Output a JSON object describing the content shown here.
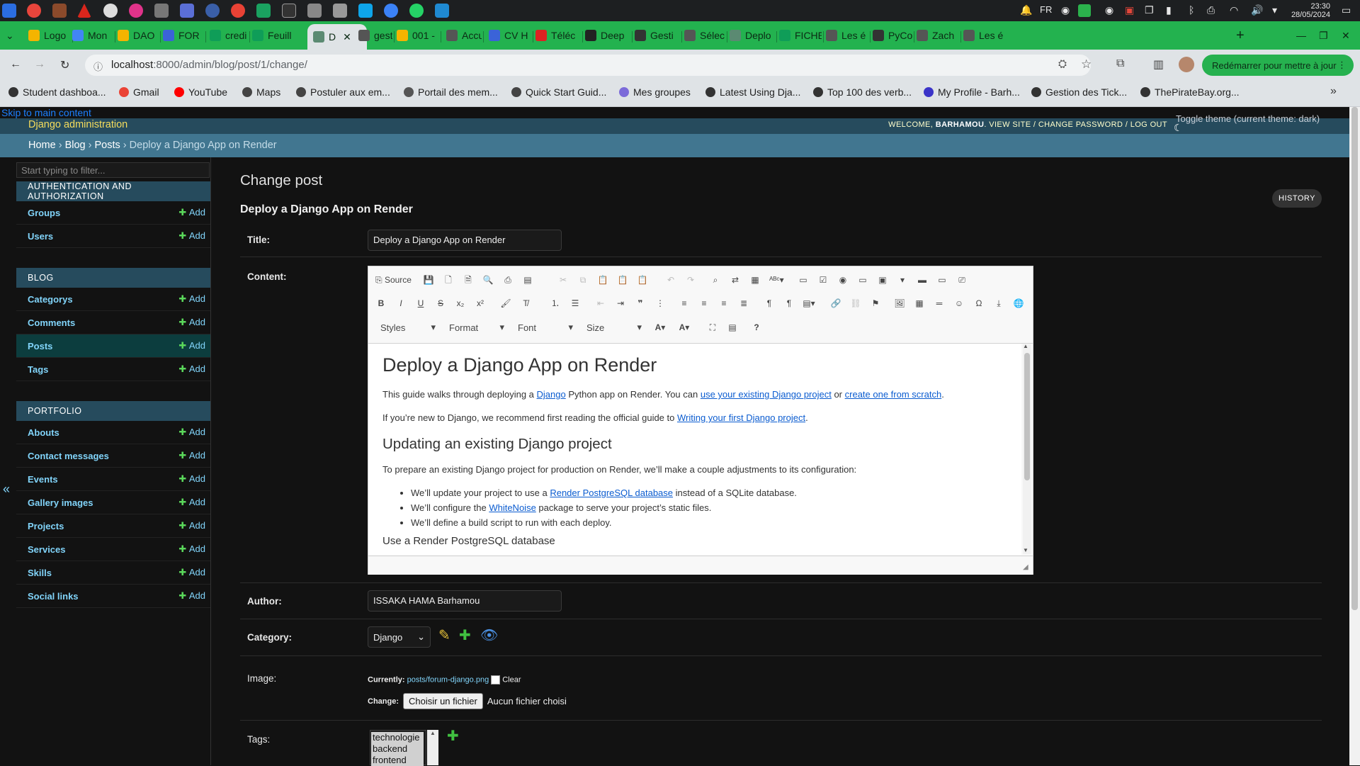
{
  "os": {
    "tray_lang": "FR",
    "clock_time": "23:30",
    "clock_date": "28/05/2024"
  },
  "browser": {
    "tabs": [
      {
        "label": "Logo",
        "color": "#f4b400"
      },
      {
        "label": "Mon",
        "color": "#4285f4"
      },
      {
        "label": "DAO",
        "color": "#f4b400"
      },
      {
        "label": "FOR",
        "color": "#3b63d8"
      },
      {
        "label": "credi",
        "color": "#0f9d58"
      },
      {
        "label": "Feuill",
        "color": "#0f9d58"
      },
      {
        "label": "D",
        "color": "#5b8a72"
      },
      {
        "label": "gestio",
        "color": "#555555"
      },
      {
        "label": "001 -",
        "color": "#f4b400"
      },
      {
        "label": "Accu",
        "color": "#555555"
      },
      {
        "label": "CV H",
        "color": "#3b63d8"
      },
      {
        "label": "Téléc",
        "color": "#d22"
      },
      {
        "label": "Deep",
        "color": "#222"
      },
      {
        "label": "Gesti",
        "color": "#333"
      },
      {
        "label": "Sélec",
        "color": "#555555"
      },
      {
        "label": "Deplo",
        "color": "#5b8a72"
      },
      {
        "label": "FICHE",
        "color": "#0f9d58"
      },
      {
        "label": "Les é",
        "color": "#555555"
      },
      {
        "label": "PyCo",
        "color": "#333"
      },
      {
        "label": "Zach",
        "color": "#555555"
      },
      {
        "label": "Les é",
        "color": "#555555"
      }
    ],
    "url_host": "localhost",
    "url_path": ":8000/admin/blog/post/1/change/",
    "restart_label": "Redémarrer pour mettre à jour",
    "bookmarks": [
      "Student dashboa...",
      "Gmail",
      "YouTube",
      "Maps",
      "Postuler aux em...",
      "Portail des mem...",
      "Quick Start Guid...",
      "Mes groupes",
      "Latest Using Dja...",
      "Top 100 des verb...",
      "My Profile - Barh...",
      "Gestion des Tick...",
      "ThePirateBay.org..."
    ]
  },
  "admin": {
    "skip_link": "Skip to main content",
    "brand": "Django administration",
    "welcome": "Welcome,",
    "username": "BARHAMOU",
    "user_links": [
      "View site",
      "Change password",
      "Log out"
    ],
    "toggle_theme": "Toggle theme (current theme: dark)",
    "breadcrumbs": [
      "Home",
      "Blog",
      "Posts",
      "Deploy a Django App on Render"
    ],
    "filter_placeholder": "Start typing to filter...",
    "add_label": "Add",
    "modules": [
      {
        "caption": "Authentication and Authorization",
        "models": [
          "Groups",
          "Users"
        ]
      },
      {
        "caption": "Blog",
        "models": [
          "Categorys",
          "Comments",
          "Posts",
          "Tags"
        ]
      },
      {
        "caption": "Portfolio",
        "models": [
          "Abouts",
          "Contact messages",
          "Events",
          "Gallery images",
          "Projects",
          "Services",
          "Skills",
          "Social links"
        ]
      }
    ],
    "selected_model": "Posts"
  },
  "form": {
    "page_title": "Change post",
    "object_title": "Deploy a Django App on Render",
    "history_label": "HISTORY",
    "title_label": "Title:",
    "title_value": "Deploy a Django App on Render",
    "content_label": "Content:",
    "author_label": "Author:",
    "author_value": "ISSAKA HAMA Barhamou",
    "category_label": "Category:",
    "category_value": "Django",
    "image_label": "Image:",
    "currently_label": "Currently:",
    "current_file": "posts/forum-django.png",
    "clear_label": "Clear",
    "change_label": "Change:",
    "file_button": "Choisir un fichier",
    "no_file": "Aucun fichier choisi",
    "tags_label": "Tags:",
    "tags_options": [
      "technologie",
      "backend",
      "frontend"
    ]
  },
  "editor": {
    "source_label": "Source",
    "combos": [
      "Styles",
      "Format",
      "Font",
      "Size"
    ],
    "doc": {
      "h1": "Deploy a Django App on Render",
      "p1_a": "This guide walks through deploying a ",
      "p1_link1": "Django",
      "p1_b": " Python app on Render. You can ",
      "p1_link2": "use your existing Django project",
      "p1_c": " or ",
      "p1_link3": "create one from scratch",
      "p1_d": ".",
      "p2_a": "If you’re new to Django, we recommend first reading the official guide to ",
      "p2_link": "Writing your first Django project",
      "p2_b": ".",
      "h2": "Updating an existing Django project",
      "p3": "To prepare an existing Django project for production on Render, we’ll make a couple adjustments to its configuration:",
      "li1_a": "We’ll update your project to use a ",
      "li1_link": "Render PostgreSQL database",
      "li1_b": " instead of a SQLite database.",
      "li2_a": "We’ll configure the ",
      "li2_link": "WhiteNoise",
      "li2_b": " package to serve your project’s static files.",
      "li3": "We’ll define a build script to run with each deploy.",
      "h3": "Use a Render PostgreSQL database"
    }
  },
  "colors": {
    "header_bg": "#264b5d",
    "breadcrumb_bg": "#417690",
    "link": "#81d4fa",
    "brand": "#f5dd5d",
    "add_plus": "#5bd85b",
    "tabstrip": "#23b24f"
  }
}
